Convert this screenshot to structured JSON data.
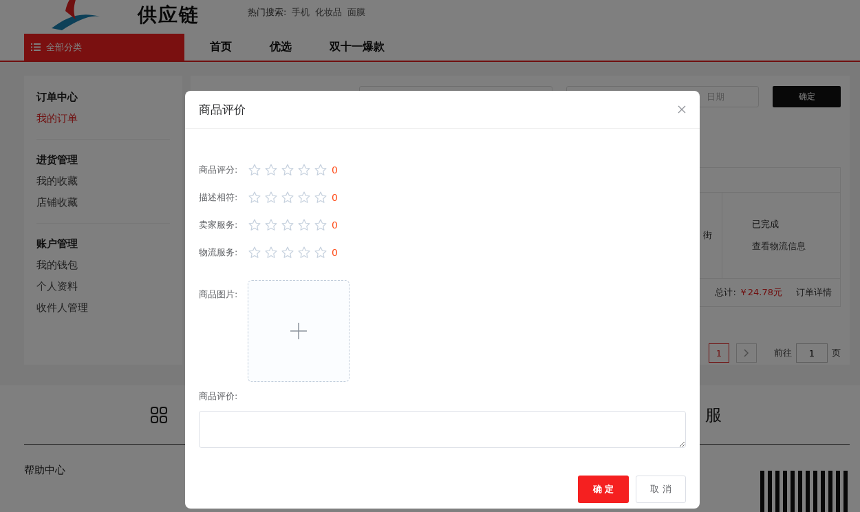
{
  "header": {
    "logo_text": "供应链",
    "hot_search_label": "热门搜索:",
    "hot_search_terms": [
      "手机",
      "化妆品",
      "面膜"
    ]
  },
  "nav": {
    "category_button": "全部分类",
    "items": [
      {
        "label": "首页"
      },
      {
        "label": "优选"
      },
      {
        "label": "双十一爆款"
      }
    ]
  },
  "sidebar": {
    "groups": [
      {
        "title": "订单中心",
        "items": [
          {
            "label": "我的订单",
            "selected": true
          }
        ]
      },
      {
        "title": "进货管理",
        "items": [
          {
            "label": "我的收藏",
            "selected": false
          },
          {
            "label": "店铺收藏",
            "selected": false
          }
        ]
      },
      {
        "title": "账户管理",
        "items": [
          {
            "label": "我的钱包",
            "selected": false
          },
          {
            "label": "个人资料",
            "selected": false
          },
          {
            "label": "收件人管理",
            "selected": false
          }
        ]
      }
    ]
  },
  "filters": {
    "date_placeholder": "日期",
    "confirm_button": "确定"
  },
  "order": {
    "cell_fragment": "街",
    "status": "已完成",
    "logistics_link": "查看物流信息",
    "total_label": "总计:",
    "total_amount": "￥24.78元",
    "detail_link": "订单详情"
  },
  "pagination": {
    "pages": [
      {
        "label": "1",
        "selected": true
      }
    ],
    "goto_label": "前往",
    "goto_value": "1",
    "page_suffix": "页"
  },
  "footer": {
    "service_text": "服",
    "help_title": "帮助中心"
  },
  "dialog": {
    "title": "商品评价",
    "ratings": [
      {
        "label": "商品评分:",
        "stars": 0,
        "score": "0"
      },
      {
        "label": "描述相符:",
        "stars": 0,
        "score": "0"
      },
      {
        "label": "卖家服务:",
        "stars": 0,
        "score": "0"
      },
      {
        "label": "物流服务:",
        "stars": 0,
        "score": "0"
      }
    ],
    "image_label": "商品图片:",
    "review_label": "商品评价:",
    "confirm_button": "确 定",
    "cancel_button": "取 消"
  }
}
